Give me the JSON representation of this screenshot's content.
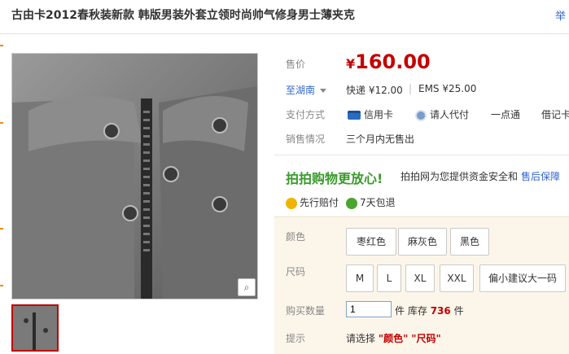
{
  "product": {
    "title": "古由卡2012春秋装新款 韩版男装外套立领时尚帅气修身男士薄夹克",
    "corner_link": "举"
  },
  "price": {
    "label": "售价",
    "currency": "¥",
    "value": "160.00"
  },
  "shipping": {
    "to_prefix": "至",
    "region": "湖南",
    "express": "快递 ¥12.00",
    "divider": "|",
    "ems": "EMS ¥25.00"
  },
  "payment": {
    "label": "支付方式",
    "methods": [
      "信用卡",
      "请人代付",
      "一点通",
      "借记卡"
    ]
  },
  "sales": {
    "label": "销售情况",
    "value": "三个月内无售出"
  },
  "assurance": {
    "slogan": "拍拍购物更放心!",
    "text": "拍拍网为您提供资金安全和",
    "link": "售后保障",
    "badges": [
      "先行赔付",
      "7天包退"
    ]
  },
  "options": {
    "color_label": "颜色",
    "colors": [
      "枣红色",
      "麻灰色",
      "黑色"
    ],
    "size_label": "尺码",
    "sizes": [
      "M",
      "L",
      "XL",
      "XXL",
      "偏小建议大一码"
    ],
    "quantity_label": "购买数量",
    "quantity_value": "1",
    "unit": "件",
    "stock_label": "库存",
    "stock_count": "736",
    "stock_unit": "件",
    "hint_label": "提示",
    "hint_prefix": "请选择",
    "hint_color": "\"颜色\"",
    "hint_size": "\"尺码\""
  },
  "colors": {
    "price_red": "#c40000",
    "link_blue": "#3366cc",
    "accent_green": "#3a9a2c",
    "option_bg": "#fcf6ea"
  },
  "icons": [
    "zoom-icon",
    "credit-card-icon",
    "pay-for-me-icon",
    "dropdown-arrow-icon",
    "compensation-badge-icon",
    "return-badge-icon"
  ]
}
